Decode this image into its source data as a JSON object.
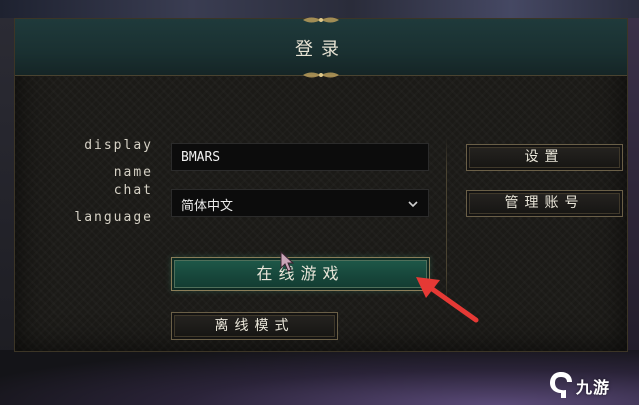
{
  "dialog": {
    "title": "登录"
  },
  "form": {
    "display_name_label_line1": "display",
    "display_name_label_line2": "name",
    "chat_language_label_line1": "chat",
    "chat_language_label_line2": "language",
    "display_name_value": "BMARS",
    "chat_language_value": "简体中文"
  },
  "buttons": {
    "settings": "设置",
    "manage_account": "管理账号",
    "play_online": "在线游戏",
    "offline_mode": "离线模式"
  },
  "annotation": {
    "arrow_color": "#e53935"
  },
  "watermark": {
    "text": "九游"
  },
  "colors": {
    "accent_green": "#1f5a4a",
    "title_bar": "#1f3a3b",
    "frame_gold": "#6a5f47"
  }
}
